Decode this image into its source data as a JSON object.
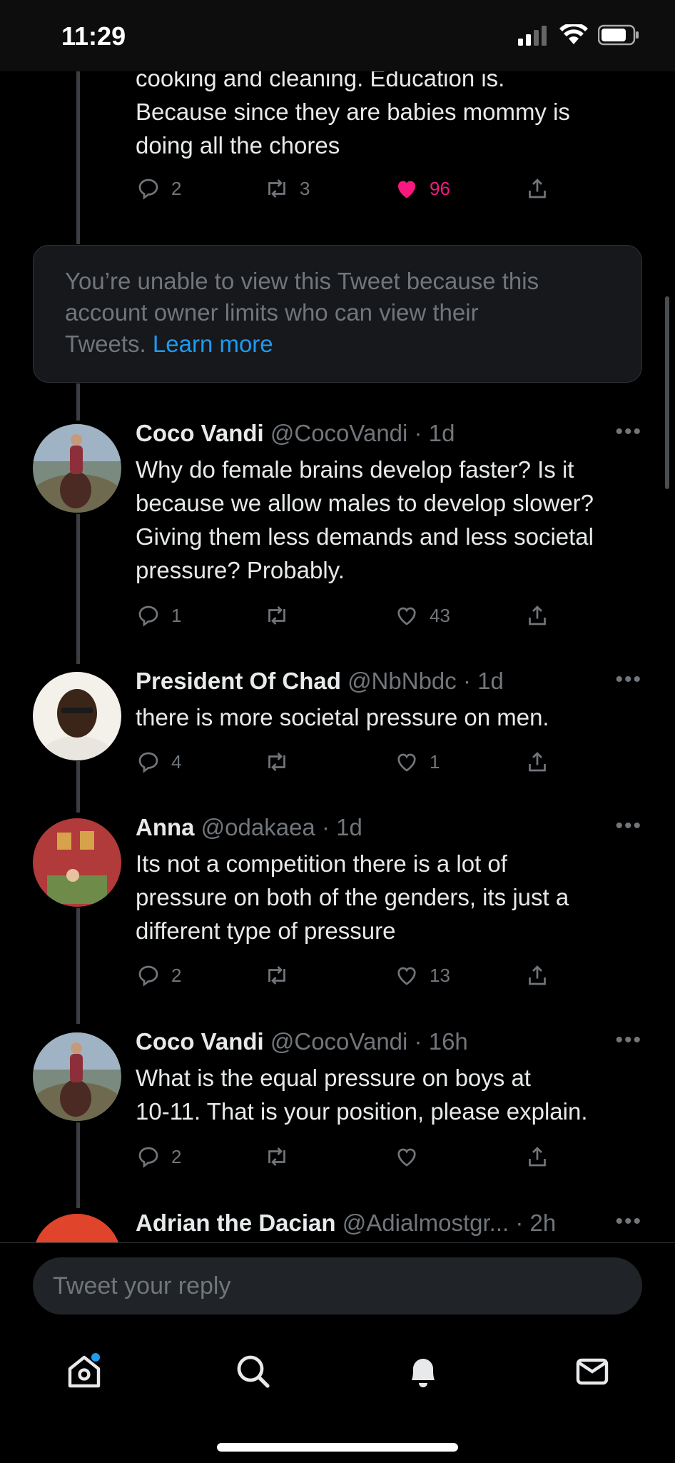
{
  "status": {
    "time": "11:29"
  },
  "tweets": [
    {
      "text_lines": [
        "cooking and cleaning. Education is.",
        "Because since they are babies mommy is",
        "doing all the chores"
      ],
      "replies": "2",
      "retweets": "3",
      "likes": "96",
      "liked": true
    },
    {
      "name": "Coco Vandi",
      "handle": "@CocoVandi",
      "time": "1d",
      "text_lines": [
        "Why do female brains develop faster? Is it",
        "because we allow males to develop slower?",
        "Giving them less demands and less societal",
        "pressure? Probably."
      ],
      "replies": "1",
      "retweets": "",
      "likes": "43"
    },
    {
      "name": "President Of Chad",
      "handle": "@NbNbdc",
      "time": "1d",
      "text_lines": [
        "there is more societal pressure on men."
      ],
      "replies": "4",
      "retweets": "",
      "likes": "1"
    },
    {
      "name": "Anna",
      "handle": "@odakaea",
      "time": "1d",
      "text_lines": [
        "Its not a competition there is a lot of",
        "pressure on both of the genders, its just a",
        "different type of pressure"
      ],
      "replies": "2",
      "retweets": "",
      "likes": "13"
    },
    {
      "name": "Coco Vandi",
      "handle": "@CocoVandi",
      "time": "16h",
      "text_lines": [
        "What is the equal pressure on boys at",
        "10-11. That is your position, please explain."
      ],
      "replies": "2",
      "retweets": "",
      "likes": ""
    },
    {
      "name": "Adrian the Dacian",
      "handle": "@Adialmostgr...",
      "time": "2h"
    }
  ],
  "locked_notice": {
    "text_line1": "You’re unable to view this Tweet because this",
    "text_line2": "account owner limits who can view their",
    "text_line3_prefix": "Tweets. ",
    "link": "Learn more"
  },
  "separator": "·",
  "more_glyph": "•••",
  "reply": {
    "placeholder": "Tweet your reply"
  },
  "tabs": [
    "home-icon",
    "search-icon",
    "notifications-icon",
    "messages-icon"
  ],
  "colors": {
    "like_active": "#f91880",
    "link": "#1d9bf0",
    "notification_dot": "#1d9bf0"
  }
}
